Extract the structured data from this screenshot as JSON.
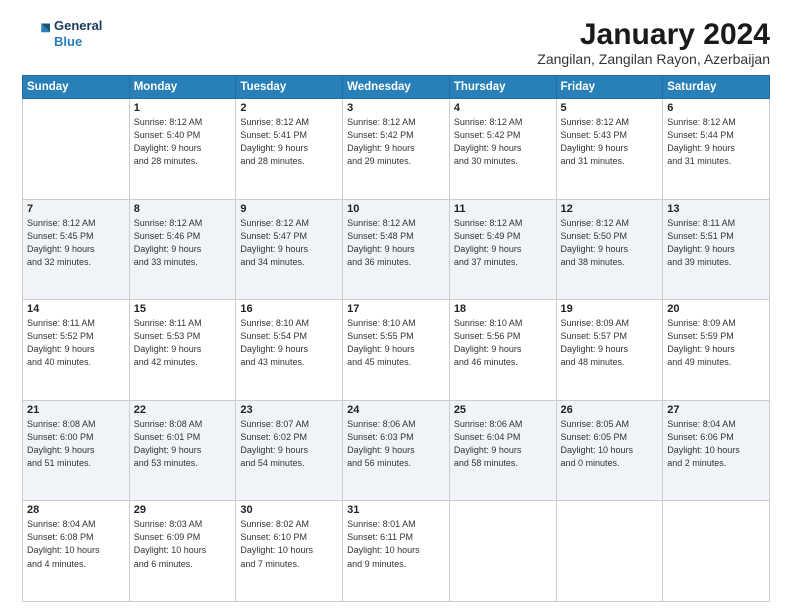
{
  "header": {
    "logo_line1": "General",
    "logo_line2": "Blue",
    "title": "January 2024",
    "subtitle": "Zangilan, Zangilan Rayon, Azerbaijan"
  },
  "days_of_week": [
    "Sunday",
    "Monday",
    "Tuesday",
    "Wednesday",
    "Thursday",
    "Friday",
    "Saturday"
  ],
  "weeks": [
    [
      {
        "day": "",
        "info": ""
      },
      {
        "day": "1",
        "info": "Sunrise: 8:12 AM\nSunset: 5:40 PM\nDaylight: 9 hours\nand 28 minutes."
      },
      {
        "day": "2",
        "info": "Sunrise: 8:12 AM\nSunset: 5:41 PM\nDaylight: 9 hours\nand 28 minutes."
      },
      {
        "day": "3",
        "info": "Sunrise: 8:12 AM\nSunset: 5:42 PM\nDaylight: 9 hours\nand 29 minutes."
      },
      {
        "day": "4",
        "info": "Sunrise: 8:12 AM\nSunset: 5:42 PM\nDaylight: 9 hours\nand 30 minutes."
      },
      {
        "day": "5",
        "info": "Sunrise: 8:12 AM\nSunset: 5:43 PM\nDaylight: 9 hours\nand 31 minutes."
      },
      {
        "day": "6",
        "info": "Sunrise: 8:12 AM\nSunset: 5:44 PM\nDaylight: 9 hours\nand 31 minutes."
      }
    ],
    [
      {
        "day": "7",
        "info": "Sunrise: 8:12 AM\nSunset: 5:45 PM\nDaylight: 9 hours\nand 32 minutes."
      },
      {
        "day": "8",
        "info": "Sunrise: 8:12 AM\nSunset: 5:46 PM\nDaylight: 9 hours\nand 33 minutes."
      },
      {
        "day": "9",
        "info": "Sunrise: 8:12 AM\nSunset: 5:47 PM\nDaylight: 9 hours\nand 34 minutes."
      },
      {
        "day": "10",
        "info": "Sunrise: 8:12 AM\nSunset: 5:48 PM\nDaylight: 9 hours\nand 36 minutes."
      },
      {
        "day": "11",
        "info": "Sunrise: 8:12 AM\nSunset: 5:49 PM\nDaylight: 9 hours\nand 37 minutes."
      },
      {
        "day": "12",
        "info": "Sunrise: 8:12 AM\nSunset: 5:50 PM\nDaylight: 9 hours\nand 38 minutes."
      },
      {
        "day": "13",
        "info": "Sunrise: 8:11 AM\nSunset: 5:51 PM\nDaylight: 9 hours\nand 39 minutes."
      }
    ],
    [
      {
        "day": "14",
        "info": "Sunrise: 8:11 AM\nSunset: 5:52 PM\nDaylight: 9 hours\nand 40 minutes."
      },
      {
        "day": "15",
        "info": "Sunrise: 8:11 AM\nSunset: 5:53 PM\nDaylight: 9 hours\nand 42 minutes."
      },
      {
        "day": "16",
        "info": "Sunrise: 8:10 AM\nSunset: 5:54 PM\nDaylight: 9 hours\nand 43 minutes."
      },
      {
        "day": "17",
        "info": "Sunrise: 8:10 AM\nSunset: 5:55 PM\nDaylight: 9 hours\nand 45 minutes."
      },
      {
        "day": "18",
        "info": "Sunrise: 8:10 AM\nSunset: 5:56 PM\nDaylight: 9 hours\nand 46 minutes."
      },
      {
        "day": "19",
        "info": "Sunrise: 8:09 AM\nSunset: 5:57 PM\nDaylight: 9 hours\nand 48 minutes."
      },
      {
        "day": "20",
        "info": "Sunrise: 8:09 AM\nSunset: 5:59 PM\nDaylight: 9 hours\nand 49 minutes."
      }
    ],
    [
      {
        "day": "21",
        "info": "Sunrise: 8:08 AM\nSunset: 6:00 PM\nDaylight: 9 hours\nand 51 minutes."
      },
      {
        "day": "22",
        "info": "Sunrise: 8:08 AM\nSunset: 6:01 PM\nDaylight: 9 hours\nand 53 minutes."
      },
      {
        "day": "23",
        "info": "Sunrise: 8:07 AM\nSunset: 6:02 PM\nDaylight: 9 hours\nand 54 minutes."
      },
      {
        "day": "24",
        "info": "Sunrise: 8:06 AM\nSunset: 6:03 PM\nDaylight: 9 hours\nand 56 minutes."
      },
      {
        "day": "25",
        "info": "Sunrise: 8:06 AM\nSunset: 6:04 PM\nDaylight: 9 hours\nand 58 minutes."
      },
      {
        "day": "26",
        "info": "Sunrise: 8:05 AM\nSunset: 6:05 PM\nDaylight: 10 hours\nand 0 minutes."
      },
      {
        "day": "27",
        "info": "Sunrise: 8:04 AM\nSunset: 6:06 PM\nDaylight: 10 hours\nand 2 minutes."
      }
    ],
    [
      {
        "day": "28",
        "info": "Sunrise: 8:04 AM\nSunset: 6:08 PM\nDaylight: 10 hours\nand 4 minutes."
      },
      {
        "day": "29",
        "info": "Sunrise: 8:03 AM\nSunset: 6:09 PM\nDaylight: 10 hours\nand 6 minutes."
      },
      {
        "day": "30",
        "info": "Sunrise: 8:02 AM\nSunset: 6:10 PM\nDaylight: 10 hours\nand 7 minutes."
      },
      {
        "day": "31",
        "info": "Sunrise: 8:01 AM\nSunset: 6:11 PM\nDaylight: 10 hours\nand 9 minutes."
      },
      {
        "day": "",
        "info": ""
      },
      {
        "day": "",
        "info": ""
      },
      {
        "day": "",
        "info": ""
      }
    ]
  ]
}
